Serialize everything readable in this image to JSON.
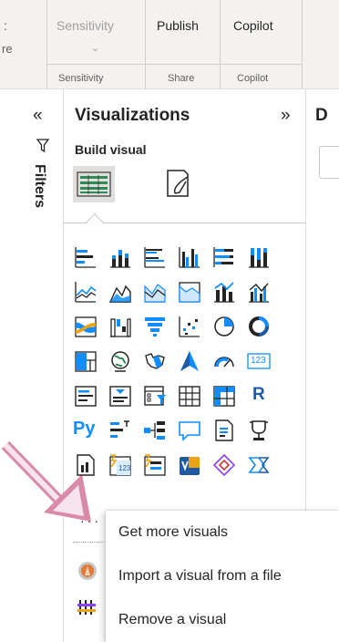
{
  "ribbon": {
    "partial_left_top": ":",
    "partial_left_mid": "re",
    "sensitivity_button": "Sensitivity",
    "sensitivity_chevron": "⌄",
    "publish_button": "Publish",
    "copilot_button": "Copilot",
    "groups": {
      "sensitivity": "Sensitivity",
      "share": "Share",
      "copilot": "Copilot"
    }
  },
  "filters": {
    "collapse_glyph": "«",
    "label": "Filters"
  },
  "visualizations": {
    "title": "Visualizations",
    "expand_glyph": "»",
    "build_visual": "Build visual",
    "icons": [
      "stacked-bar-chart-icon",
      "stacked-column-chart-icon",
      "clustered-bar-chart-icon",
      "clustered-column-chart-icon",
      "100-stacked-bar-chart-icon",
      "100-stacked-column-chart-icon",
      "line-chart-icon",
      "area-chart-icon",
      "stacked-area-chart-icon",
      "100-stacked-area-chart-icon",
      "line-and-stacked-column-chart-icon",
      "line-and-clustered-column-chart-icon",
      "ribbon-chart-icon",
      "waterfall-chart-icon",
      "funnel-chart-icon",
      "scatter-chart-icon",
      "pie-chart-icon",
      "donut-chart-icon",
      "treemap-icon",
      "map-icon",
      "filled-map-icon",
      "azure-map-icon",
      "gauge-icon",
      "card-icon",
      "multi-row-card-icon",
      "kpi-icon",
      "slicer-icon",
      "table-icon",
      "matrix-icon",
      "r-script-visual-icon",
      "python-visual-icon",
      "key-influencers-icon",
      "decomposition-tree-icon",
      "qa-icon",
      "smart-narrative-icon",
      "metrics-icon",
      "paginated-report-icon",
      "power-apps-icon",
      "power-automate-icon",
      "visio-icon",
      "custom-visual-icon",
      "arcgis-icon"
    ],
    "card_label": "123",
    "r_label": "R",
    "py_label": "Py",
    "more_glyph": "···"
  },
  "data_pane": {
    "title_partial": "D"
  },
  "context_menu": {
    "items": [
      "Get more visuals",
      "Import a visual from a file",
      "Remove a visual"
    ]
  },
  "colors": {
    "accent_blue": "#118dff",
    "dark_blue": "#1f5aa3",
    "green": "#2e8b57",
    "orange": "#e8a317",
    "purple": "#8a3ffc",
    "annotation_pink": "#d88ba8"
  }
}
